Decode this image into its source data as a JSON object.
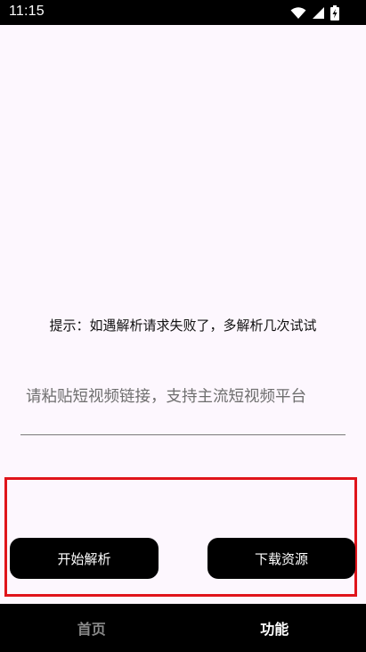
{
  "status_bar": {
    "time": "11:15",
    "icons": [
      "wifi-icon",
      "signal-icon",
      "battery-charging-icon"
    ]
  },
  "main": {
    "hint": "提示：如遇解析请求失败了，多解析几次试试",
    "link_input": {
      "value": "",
      "placeholder": "请粘贴短视频链接，支持主流短视频平台"
    },
    "buttons": {
      "parse_label": "开始解析",
      "download_label": "下载资源"
    }
  },
  "bottom_nav": {
    "items": [
      {
        "label": "首页",
        "active": false
      },
      {
        "label": "功能",
        "active": true
      }
    ]
  },
  "colors": {
    "background": "#fdf7fe",
    "bar": "#000000",
    "highlight": "#e0141b",
    "nav_inactive": "#8a8a8a",
    "nav_active": "#ffffff"
  }
}
